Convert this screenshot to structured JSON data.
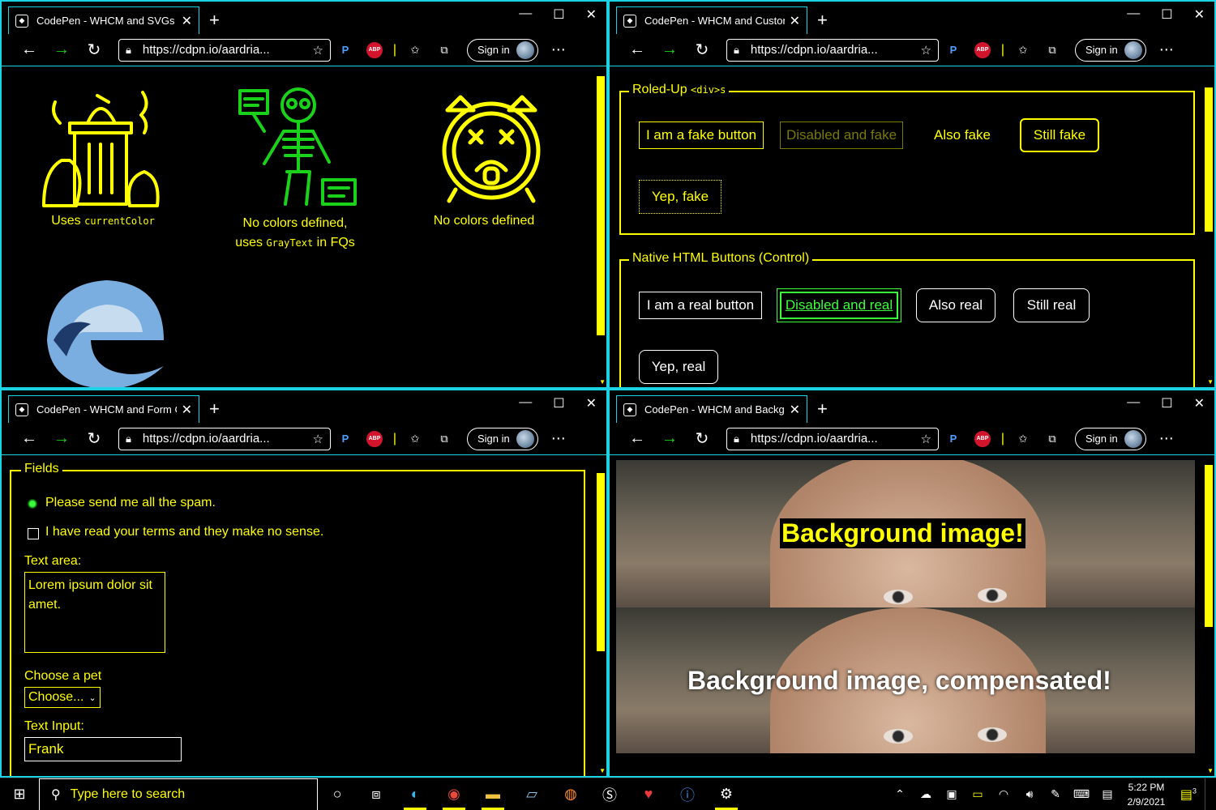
{
  "browser": {
    "url": "https://cdpn.io/aardria...",
    "signin": "Sign in",
    "newtab": "+",
    "menu": "⋯",
    "minimize": "—",
    "maximize": "☐",
    "close": "✕",
    "abp": "ABP",
    "ext_p": "P"
  },
  "windows": {
    "tl": {
      "tab_title": "CodePen - WHCM and SVGs"
    },
    "tr": {
      "tab_title": "CodePen - WHCM and Custom E"
    },
    "bl": {
      "tab_title": "CodePen - WHCM and Form Co"
    },
    "br": {
      "tab_title": "CodePen - WHCM and Backgrou"
    }
  },
  "svgs": {
    "item1_prefix": "Uses ",
    "item1_code": "currentColor",
    "item2_line1": "No colors defined,",
    "item2_prefix": "uses ",
    "item2_code": "GrayText",
    "item2_suffix": " in FQs",
    "item3": "No colors defined"
  },
  "custom": {
    "fieldset1_legend": "Roled-Up ",
    "fieldset1_code": "<div>s",
    "fake_buttons": [
      "I am a fake button",
      "Disabled and fake",
      "Also fake",
      "Still fake",
      "Yep, fake"
    ],
    "fieldset2_legend": "Native HTML Buttons (Control)",
    "real_buttons": [
      "I am a real button",
      "Disabled and real",
      "Also real",
      "Still real",
      "Yep, real"
    ]
  },
  "form": {
    "legend": "Fields",
    "radio_label": "Please send me all the spam.",
    "checkbox_label": "I have read your terms and they make no sense.",
    "textarea_label": "Text area:",
    "textarea_value": "Lorem ipsum dolor sit amet.",
    "select_label": "Choose a pet",
    "select_value": "Choose...",
    "input_label": "Text Input:",
    "input_value": "Frank"
  },
  "backgrounds": {
    "label1": "Background image!",
    "label2": "Background image, compensated!"
  },
  "taskbar": {
    "search_placeholder": "Type here to search",
    "time": "5:22 PM",
    "date": "2/9/2021",
    "notif_count": "3"
  },
  "colors": {
    "accent": "#ffff00",
    "border": "#1ad4e6",
    "green": "#3cff3c"
  }
}
